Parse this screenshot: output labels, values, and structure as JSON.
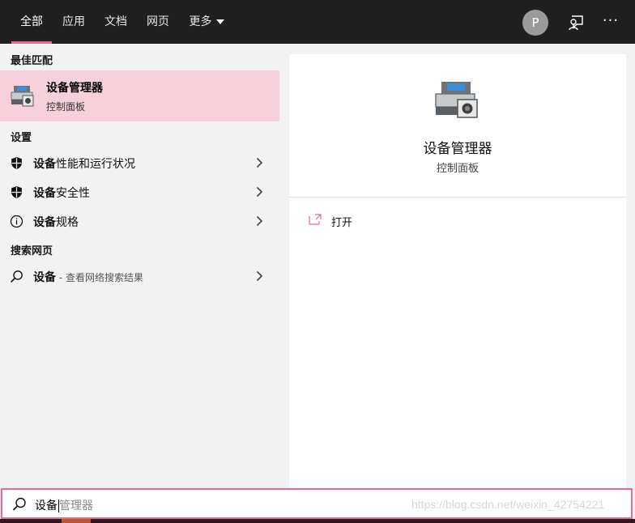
{
  "tabs": [
    {
      "label": "全部",
      "active": true
    },
    {
      "label": "应用",
      "active": false
    },
    {
      "label": "文档",
      "active": false
    },
    {
      "label": "网页",
      "active": false
    },
    {
      "label": "更多",
      "active": false
    }
  ],
  "account": {
    "initial": "P"
  },
  "icons": {
    "feedback": "feedback-icon",
    "more": "more-options-icon",
    "search": "search-icon"
  },
  "colors": {
    "accent": "#e86b8d",
    "best_match_bg": "#f6d0da",
    "topbar": "#1f1f1f"
  },
  "best_match": {
    "section": "最佳匹配",
    "title": "设备管理器",
    "subtitle": "控制面板"
  },
  "settings": {
    "section": "设置",
    "items": [
      {
        "bold": "设备",
        "rest": "性能和运行状况",
        "icon": "shield-icon"
      },
      {
        "bold": "设备",
        "rest": "安全性",
        "icon": "shield-icon"
      },
      {
        "bold": "设备",
        "rest": "规格",
        "icon": "info-icon"
      }
    ]
  },
  "web": {
    "section": "搜索网页",
    "item": {
      "bold": "设备",
      "sub": " - 查看网络搜索结果"
    }
  },
  "preview": {
    "title": "设备管理器",
    "subtitle": "控制面板",
    "actions": [
      {
        "label": "打开"
      }
    ]
  },
  "search": {
    "typed": "设备",
    "suggestion": "管理器",
    "watermark": "https://blog.csdn.net/weixin_42754221"
  }
}
